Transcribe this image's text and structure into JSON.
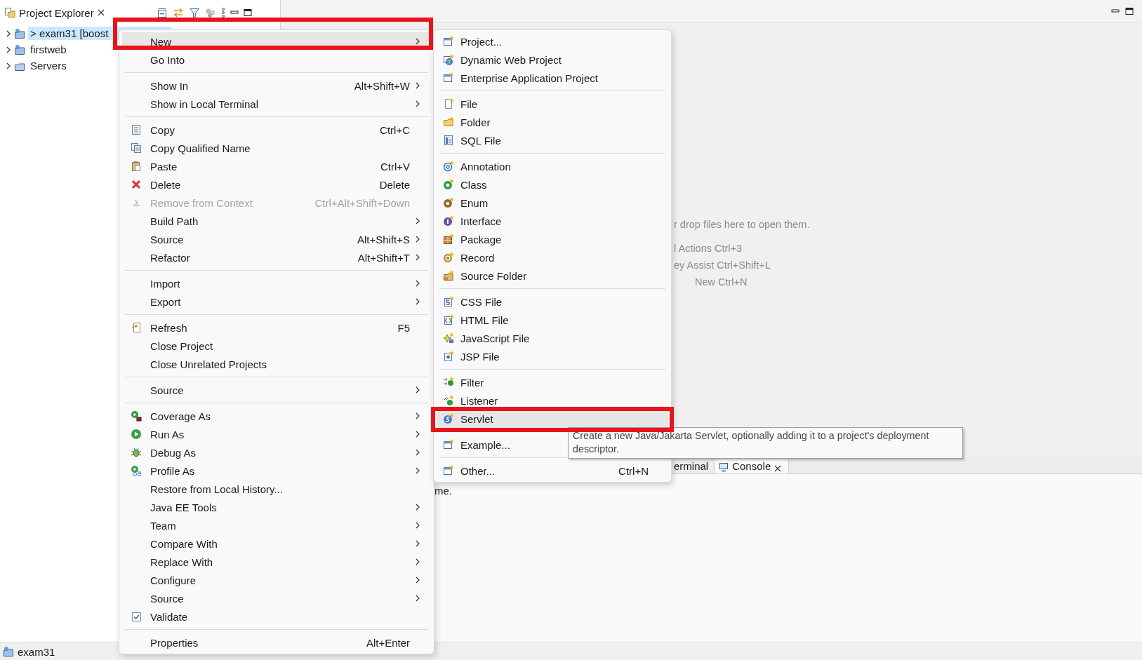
{
  "explorer": {
    "tab": {
      "label": "Project Explorer"
    },
    "tree": [
      {
        "label": "> exam31 [boost",
        "selected": true
      },
      {
        "label": "firstweb",
        "selected": false
      },
      {
        "label": "Servers",
        "selected": false
      }
    ]
  },
  "context_menu": {
    "groups": [
      {
        "items": [
          {
            "label": "New",
            "submenu": true,
            "selected": true,
            "disabled": false,
            "checked": false
          },
          {
            "label": "Go Into",
            "submenu": false,
            "selected": false,
            "disabled": false,
            "checked": false
          }
        ]
      },
      {
        "items": [
          {
            "label": "Show In",
            "shortcut": "Alt+Shift+W",
            "submenu": true,
            "selected": false,
            "disabled": false,
            "checked": false
          },
          {
            "label": "Show in Local Terminal",
            "submenu": true,
            "selected": false,
            "disabled": false,
            "checked": false
          }
        ]
      },
      {
        "items": [
          {
            "label": "Copy",
            "shortcut": "Ctrl+C",
            "submenu": false,
            "selected": false,
            "disabled": false,
            "checked": false
          },
          {
            "label": "Copy Qualified Name",
            "submenu": false,
            "selected": false,
            "disabled": false,
            "checked": false
          },
          {
            "label": "Paste",
            "shortcut": "Ctrl+V",
            "submenu": false,
            "selected": false,
            "disabled": false,
            "checked": false
          },
          {
            "label": "Delete",
            "shortcut": "Delete",
            "submenu": false,
            "selected": false,
            "disabled": false,
            "checked": false
          },
          {
            "label": "Remove from Context",
            "shortcut": "Ctrl+Alt+Shift+Down",
            "submenu": false,
            "selected": false,
            "disabled": true,
            "checked": false
          },
          {
            "label": "Build Path",
            "submenu": true,
            "selected": false,
            "disabled": false,
            "checked": false
          },
          {
            "label": "Source",
            "shortcut": "Alt+Shift+S",
            "submenu": true,
            "selected": false,
            "disabled": false,
            "checked": false
          },
          {
            "label": "Refactor",
            "shortcut": "Alt+Shift+T",
            "submenu": true,
            "selected": false,
            "disabled": false,
            "checked": false
          }
        ]
      },
      {
        "items": [
          {
            "label": "Import",
            "submenu": true,
            "selected": false,
            "disabled": false,
            "checked": false
          },
          {
            "label": "Export",
            "submenu": true,
            "selected": false,
            "disabled": false,
            "checked": false
          }
        ]
      },
      {
        "items": [
          {
            "label": "Refresh",
            "shortcut": "F5",
            "submenu": false,
            "selected": false,
            "disabled": false,
            "checked": false
          },
          {
            "label": "Close Project",
            "submenu": false,
            "selected": false,
            "disabled": false,
            "checked": false
          },
          {
            "label": "Close Unrelated Projects",
            "submenu": false,
            "selected": false,
            "disabled": false,
            "checked": false
          }
        ]
      },
      {
        "items": [
          {
            "label": "Source",
            "submenu": true,
            "selected": false,
            "disabled": false,
            "checked": false
          }
        ]
      },
      {
        "items": [
          {
            "label": "Coverage As",
            "submenu": true,
            "selected": false,
            "disabled": false,
            "checked": false
          },
          {
            "label": "Run As",
            "submenu": true,
            "selected": false,
            "disabled": false,
            "checked": false
          },
          {
            "label": "Debug As",
            "submenu": true,
            "selected": false,
            "disabled": false,
            "checked": false
          },
          {
            "label": "Profile As",
            "submenu": true,
            "selected": false,
            "disabled": false,
            "checked": false
          },
          {
            "label": "Restore from Local History...",
            "submenu": false,
            "selected": false,
            "disabled": false,
            "checked": false
          },
          {
            "label": "Java EE Tools",
            "submenu": true,
            "selected": false,
            "disabled": false,
            "checked": false
          },
          {
            "label": "Team",
            "submenu": true,
            "selected": false,
            "disabled": false,
            "checked": false
          },
          {
            "label": "Compare With",
            "submenu": true,
            "selected": false,
            "disabled": false,
            "checked": false
          },
          {
            "label": "Replace With",
            "submenu": true,
            "selected": false,
            "disabled": false,
            "checked": false
          },
          {
            "label": "Configure",
            "submenu": true,
            "selected": false,
            "disabled": false,
            "checked": false
          },
          {
            "label": "Source",
            "submenu": true,
            "selected": false,
            "disabled": false,
            "checked": false
          },
          {
            "label": "Validate",
            "submenu": false,
            "selected": false,
            "disabled": false,
            "checked": true
          }
        ]
      },
      {
        "items": [
          {
            "label": "Properties",
            "shortcut": "Alt+Enter",
            "submenu": false,
            "selected": false,
            "disabled": false,
            "checked": false
          }
        ]
      }
    ]
  },
  "new_submenu": {
    "groups": [
      {
        "items": [
          {
            "label": "Project...",
            "selected": false
          },
          {
            "label": "Dynamic Web Project",
            "selected": false
          },
          {
            "label": "Enterprise Application Project",
            "selected": false
          }
        ]
      },
      {
        "items": [
          {
            "label": "File",
            "selected": false
          },
          {
            "label": "Folder",
            "selected": false
          },
          {
            "label": "SQL File",
            "selected": false
          }
        ]
      },
      {
        "items": [
          {
            "label": "Annotation",
            "selected": false
          },
          {
            "label": "Class",
            "selected": false
          },
          {
            "label": "Enum",
            "selected": false
          },
          {
            "label": "Interface",
            "selected": false
          },
          {
            "label": "Package",
            "selected": false
          },
          {
            "label": "Record",
            "selected": false
          },
          {
            "label": "Source Folder",
            "selected": false
          }
        ]
      },
      {
        "items": [
          {
            "label": "CSS File",
            "selected": false
          },
          {
            "label": "HTML File",
            "selected": false
          },
          {
            "label": "JavaScript File",
            "selected": false
          },
          {
            "label": "JSP File",
            "selected": false
          }
        ]
      },
      {
        "items": [
          {
            "label": "Filter",
            "selected": false
          },
          {
            "label": "Listener",
            "selected": false
          },
          {
            "label": "Servlet",
            "selected": true
          }
        ]
      },
      {
        "items": [
          {
            "label": "Example...",
            "selected": false
          }
        ]
      },
      {
        "items": [
          {
            "label": "Other...",
            "shortcut": "Ctrl+N",
            "selected": false
          }
        ]
      }
    ]
  },
  "tooltip": "Create a new Java/Jakarta Servlet, optionally adding it to a project's deployment descriptor.",
  "editor": {
    "hints": [
      "r drop files here to open them.",
      "l Actions Ctrl+3",
      "ey Assist Ctrl+Shift+L",
      "New Ctrl+N"
    ]
  },
  "bottom_panel": {
    "tabs": [
      {
        "label": "erminal",
        "selected": false
      },
      {
        "label": "Console",
        "selected": true
      }
    ],
    "text": "me."
  },
  "status_bar": {
    "label": "exam31"
  }
}
